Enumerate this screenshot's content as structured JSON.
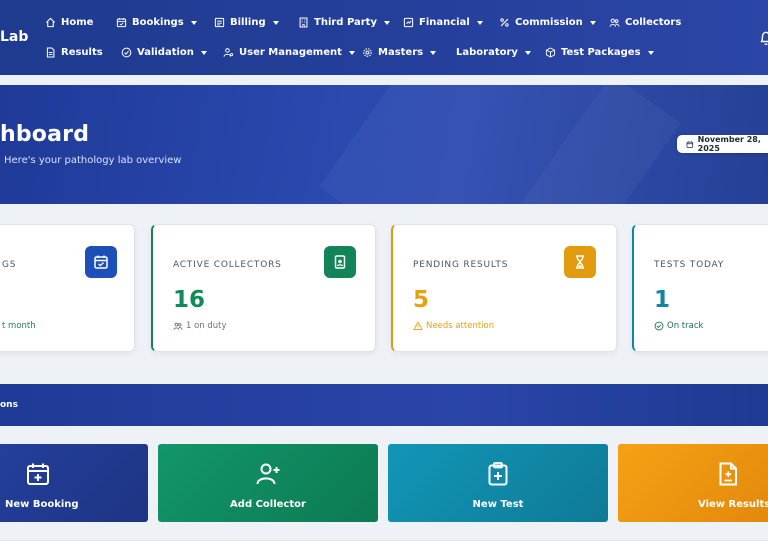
{
  "brand": "Lab",
  "nav_row1": [
    {
      "label": "Home",
      "icon": "home-icon",
      "dropdown": false
    },
    {
      "label": "Bookings",
      "icon": "calendar-icon",
      "dropdown": true
    },
    {
      "label": "Billing",
      "icon": "receipt-icon",
      "dropdown": true
    },
    {
      "label": "Third Party",
      "icon": "building-icon",
      "dropdown": true
    },
    {
      "label": "Financial",
      "icon": "finance-icon",
      "dropdown": true
    },
    {
      "label": "Commission",
      "icon": "percent-icon",
      "dropdown": true
    },
    {
      "label": "Collectors",
      "icon": "users-icon",
      "dropdown": false
    }
  ],
  "nav_row2": [
    {
      "label": "Results",
      "icon": "document-icon",
      "dropdown": false
    },
    {
      "label": "Validation",
      "icon": "check-circle-icon",
      "dropdown": true
    },
    {
      "label": "User Management",
      "icon": "user-gear-icon",
      "dropdown": true
    },
    {
      "label": "Masters",
      "icon": "gear-icon",
      "dropdown": true
    },
    {
      "label": "Laboratory",
      "icon": "",
      "dropdown": true
    },
    {
      "label": "Test Packages",
      "icon": "box-icon",
      "dropdown": true
    }
  ],
  "hero": {
    "title": "hboard",
    "subtitle": "Here's your pathology lab overview",
    "date": "November 28, 2025"
  },
  "cards": [
    {
      "label": "GS",
      "value": "",
      "foot": "t month",
      "accent": "#1d4fb8",
      "value_color": "#1d4fb8",
      "foot_color": "#2f7a59"
    },
    {
      "label": "ACTIVE COLLECTORS",
      "value": "16",
      "foot": "1 on duty",
      "accent": "#118458",
      "value_color": "#138a5c",
      "foot_color": "#6b7280"
    },
    {
      "label": "PENDING RESULTS",
      "value": "5",
      "foot": "Needs attention",
      "accent": "#e29a0e",
      "value_color": "#e6a10f",
      "foot_color": "#e6a10f"
    },
    {
      "label": "TESTS TODAY",
      "value": "1",
      "foot": "On track",
      "accent": "#0f86a8",
      "value_color": "#0f86a8",
      "foot_color": "#1f6f5c"
    }
  ],
  "quick_actions": {
    "title": "ons",
    "buttons": [
      {
        "label": "New Booking",
        "icon": "calendar-plus-icon"
      },
      {
        "label": "Add Collector",
        "icon": "user-plus-icon"
      },
      {
        "label": "New Test",
        "icon": "clipboard-plus-icon"
      },
      {
        "label": "View Results",
        "icon": "file-medical-icon"
      }
    ]
  },
  "colors": {
    "nav": "#243f9a",
    "green": "#11875a",
    "teal": "#0f86a8",
    "orange": "#f29a12",
    "blue": "#1e3a92"
  }
}
